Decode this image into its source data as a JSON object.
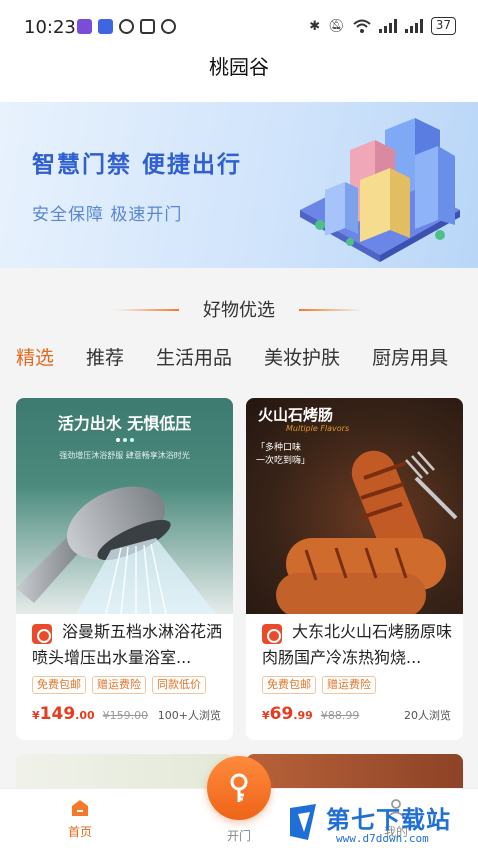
{
  "status_bar": {
    "time": "10:23",
    "battery": "37",
    "left_icons": [
      "app-badge-icon",
      "app-badge-icon",
      "nfc-like-icon",
      "n-icon",
      "alarm-icon"
    ],
    "right_icons": [
      "bluetooth-icon",
      "mute-icon",
      "wifi-icon",
      "signal-icon",
      "signal-icon",
      "battery-icon"
    ]
  },
  "header": {
    "title": "桃园谷"
  },
  "banner": {
    "headline": "智慧门禁 便捷出行",
    "subline": "安全保障 极速开门",
    "colors": {
      "headline": "#2f5fd0",
      "subline": "#5a86d8"
    }
  },
  "section": {
    "title": "好物优选"
  },
  "tabs": [
    {
      "label": "精选",
      "active": true
    },
    {
      "label": "推荐",
      "active": false
    },
    {
      "label": "生活用品",
      "active": false
    },
    {
      "label": "美妆护肤",
      "active": false
    },
    {
      "label": "厨房用具",
      "active": false
    }
  ],
  "products": [
    {
      "image_headline": "活力出水 无惧低压",
      "image_subline": "强劲增压沐浴舒服 肆意畅享沐浴时光",
      "name": "浴曼斯五档水淋浴花洒喷头增压出水量浴室...",
      "tags": [
        "免费包邮",
        "赠运费险",
        "同款低价"
      ],
      "price_symbol": "¥",
      "price_int": "149",
      "price_dec": ".00",
      "original_price": "¥159.00",
      "views": "100+人浏览"
    },
    {
      "image_headline": "火山石烤肠",
      "image_script": "Multiple Flavors",
      "image_bubble": "「多种口味\n一次吃到嗨」",
      "name": "大东北火山石烤肠原味肉肠国产冷冻热狗烧...",
      "tags": [
        "免费包邮",
        "赠运费险"
      ],
      "price_symbol": "¥",
      "price_int": "69",
      "price_dec": ".99",
      "original_price": "¥88.99",
      "views": "20人浏览"
    }
  ],
  "bottom_nav": {
    "home": "首页",
    "door": "开门",
    "mine": "我的",
    "accent": "#e66a1e"
  },
  "watermark": {
    "title": "第七下载站",
    "url": "www.d7down.com"
  }
}
